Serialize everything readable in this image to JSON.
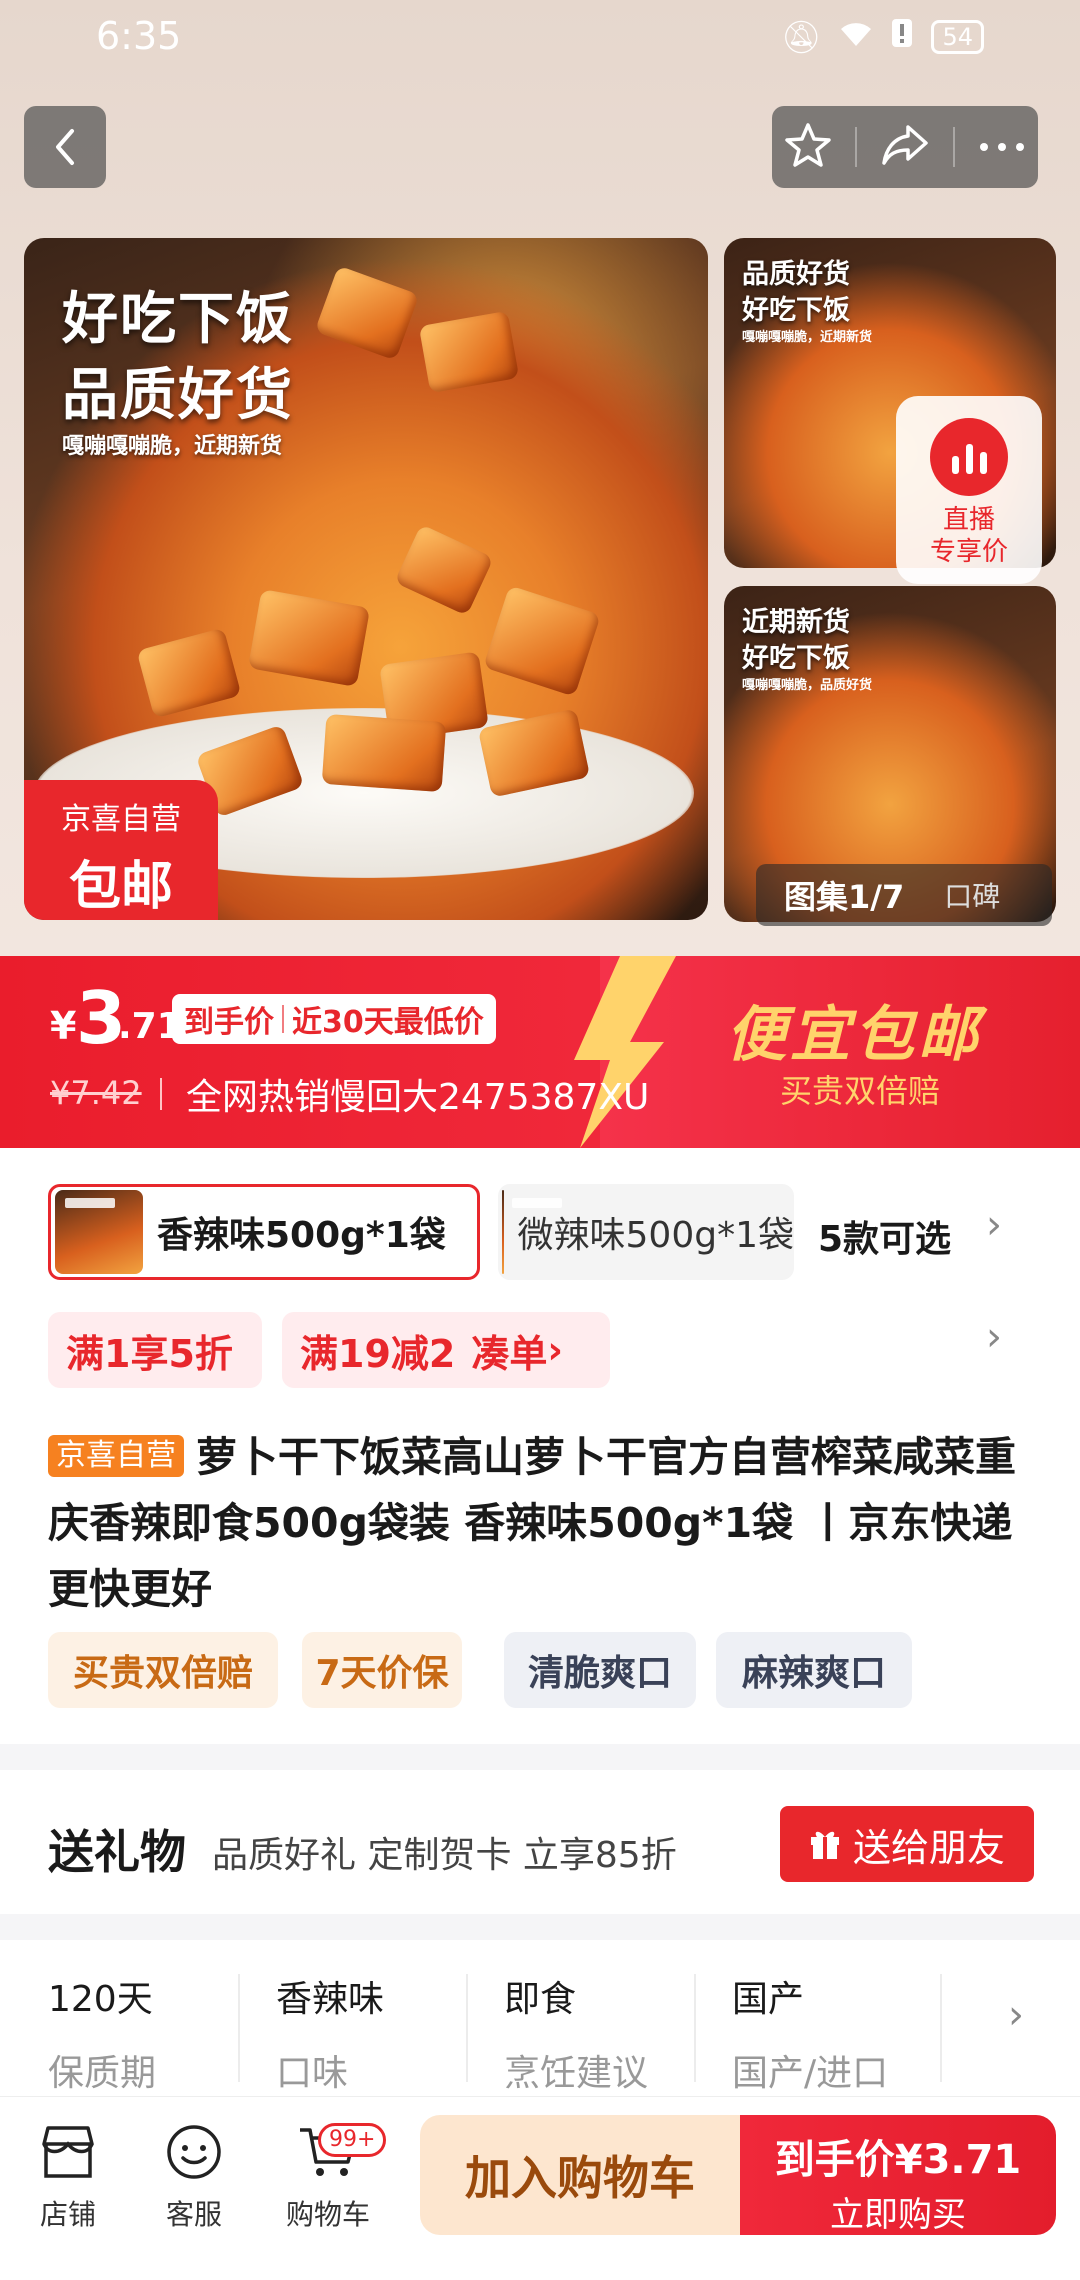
{
  "status": {
    "time": "6:35",
    "battery": "54"
  },
  "gallery": {
    "main_title_1": "好吃下饭",
    "main_title_2": "品质好货",
    "main_sub": "嘎嘣嘎嘣脆，近期新货",
    "badge_line1": "京喜自营",
    "badge_line2": "包邮",
    "thumb1_title_1": "品质好货",
    "thumb1_title_2": "好吃下饭",
    "thumb1_sub": "嘎嘣嘎嘣脆，近期新货",
    "thumb2_title_1": "近期新货",
    "thumb2_title_2": "好吃下饭",
    "thumb2_sub": "嘎嘣嘎嘣脆，品质好货",
    "live_line1": "直播",
    "live_line2": "专享价",
    "gallery_count": "图集1/7",
    "reviews": "口碑"
  },
  "price": {
    "yen": "¥",
    "int": "3",
    "dec": ".71",
    "tag_1": "到手价",
    "tag_2": "近30天最低价",
    "original": "¥7.42",
    "hot": "全网热销慢回大2475387XU",
    "slogan": "便宜包邮",
    "slogan_sub": "买贵双倍赔"
  },
  "specs": {
    "selected": "香辣味500g*1袋",
    "other": "微辣味500g*1袋",
    "count": "5款可选"
  },
  "promos": {
    "p1": "满1享5折",
    "p2": "满19减2",
    "p2_action": "凑单"
  },
  "product": {
    "tag": "京喜自营",
    "title": "萝卜干下饭菜高山萝卜干官方自营榨菜咸菜重庆香辣即食500g袋装 香辣味500g*1袋 丨京东快递 更快更好"
  },
  "chips": [
    "买贵双倍赔",
    "7天价保",
    "清脆爽口",
    "麻辣爽口"
  ],
  "gift": {
    "title": "送礼物",
    "sub": "品质好礼 定制贺卡 立享85折",
    "button": "送给朋友"
  },
  "attributes": [
    {
      "value": "120天",
      "key": "保质期"
    },
    {
      "value": "香辣味",
      "key": "口味"
    },
    {
      "value": "即食",
      "key": "烹饪建议"
    },
    {
      "value": "国产",
      "key": "国产/进口"
    }
  ],
  "bottom": {
    "shop": "店铺",
    "service": "客服",
    "cart": "购物车",
    "cart_badge": "99+",
    "add_cart": "加入购物车",
    "buy_price": "到手价¥3.71",
    "buy_now": "立即购买"
  },
  "colors": {
    "accent": "#e8272c",
    "gold": "#ffd36b",
    "orange_tag": "#f68120"
  }
}
